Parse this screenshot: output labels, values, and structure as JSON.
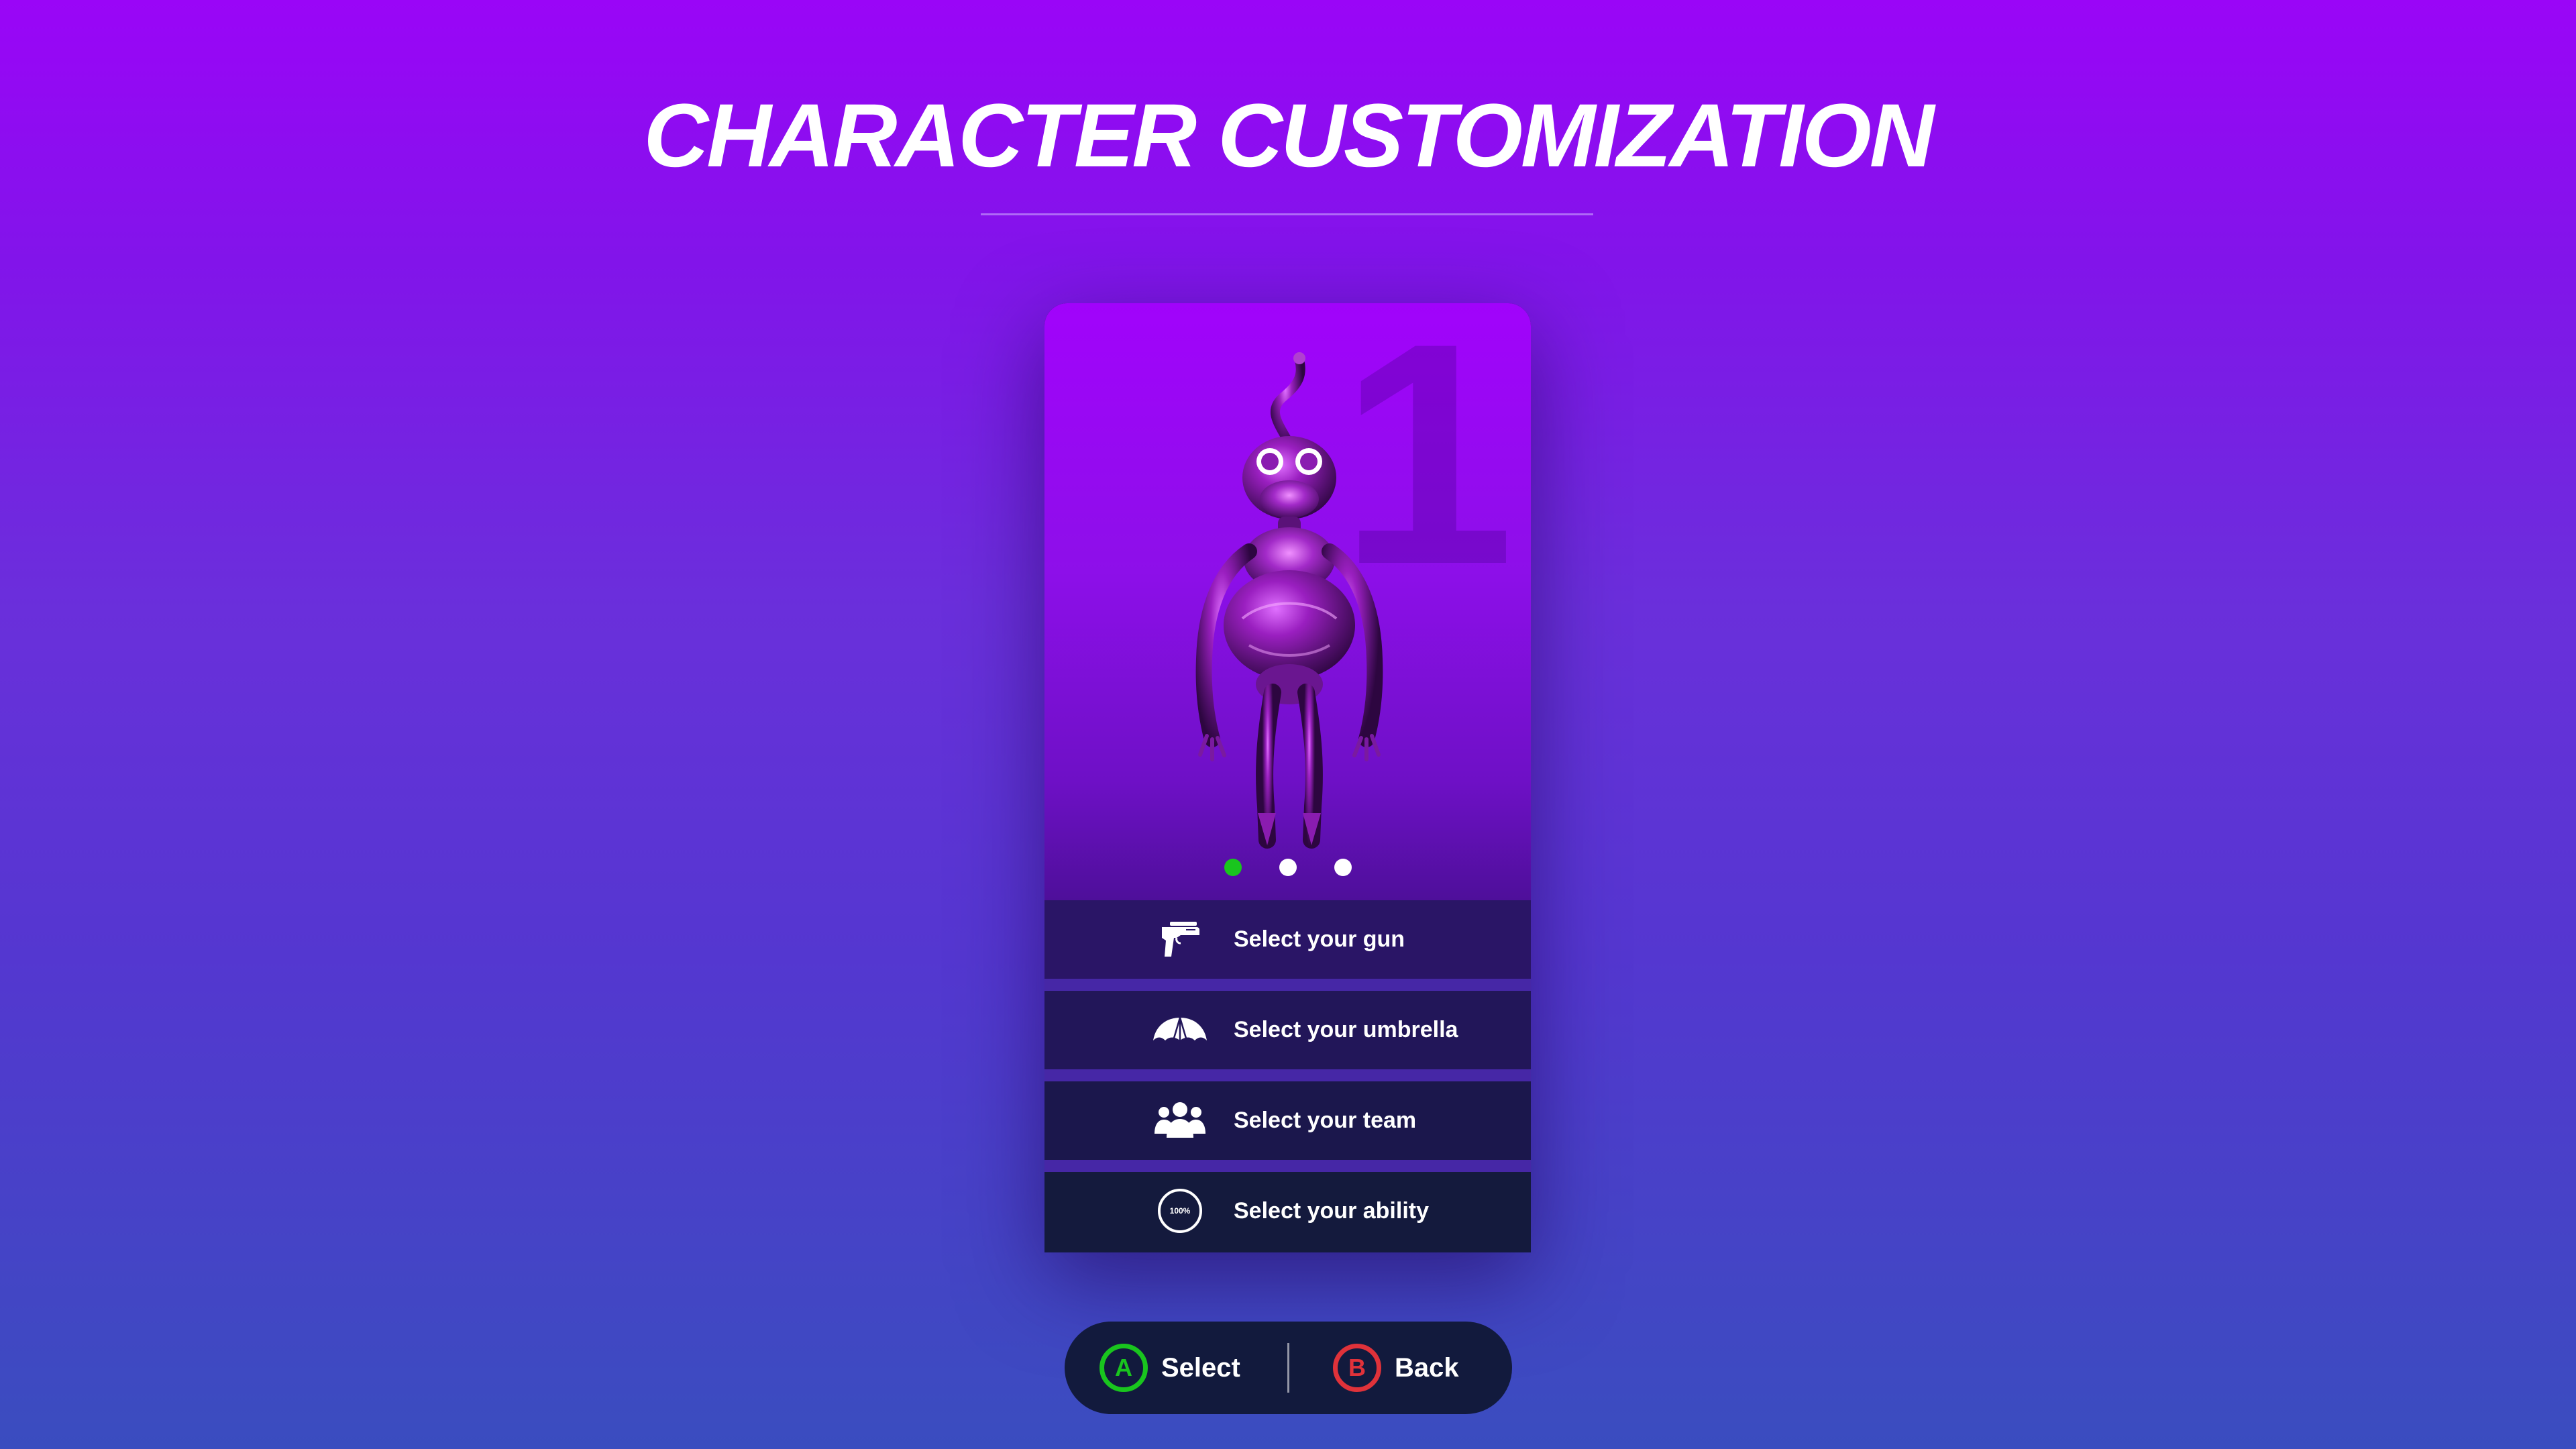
{
  "screen": {
    "title": "CHARACTER CUSTOMIZATION"
  },
  "character_card": {
    "number": "1",
    "character_name": "purple-alien-character",
    "pager": {
      "count": 3,
      "active_index": 0,
      "active_color": "#19c51e",
      "inactive_color": "#ffffff"
    }
  },
  "menu": {
    "items": [
      {
        "label": "Select your gun",
        "icon": "pistol-icon",
        "bg": "#2a1566"
      },
      {
        "label": "Select your umbrella",
        "icon": "umbrella-icon",
        "bg": "#221659"
      },
      {
        "label": "Select your team",
        "icon": "team-icon",
        "bg": "#1b174c"
      },
      {
        "label": "Select your ability",
        "icon": "ability-icon",
        "icon_text": "100%",
        "bg": "#141a3d"
      }
    ],
    "separator_color": "#4627a6"
  },
  "controls": {
    "select": {
      "button": "A",
      "label": "Select",
      "color": "#19c51e"
    },
    "back": {
      "button": "B",
      "label": "Back",
      "color": "#e0323a"
    }
  },
  "colors": {
    "background_top": "#9a05f7",
    "background_bottom": "#3a4dbf",
    "card_hero_top": "#a103fb",
    "controls_bg": "#121a3d"
  }
}
